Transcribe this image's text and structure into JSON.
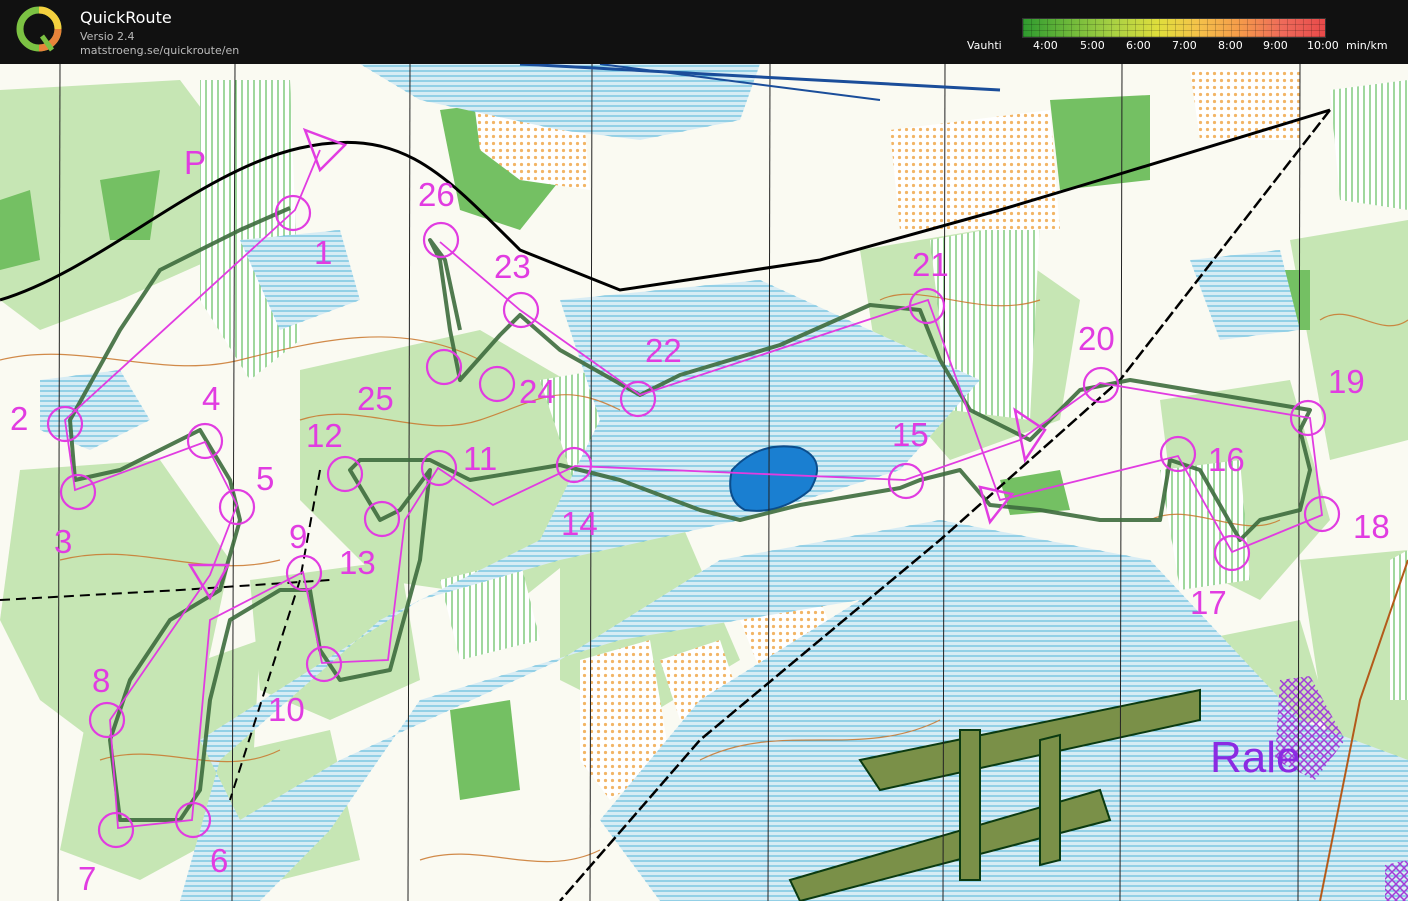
{
  "app": {
    "name": "QuickRoute",
    "version": "Versio 2.4",
    "url": "matstroeng.se/quickroute/en"
  },
  "legend": {
    "label": "Vauhti",
    "unit": "min/km",
    "ticks": [
      "4:00",
      "5:00",
      "6:00",
      "7:00",
      "8:00",
      "9:00",
      "10:00"
    ],
    "colors": {
      "slow": "#e84a4a",
      "medium": "#e0de3c",
      "fast": "#2f9a2f"
    }
  },
  "map": {
    "course_color": "#e13ce1",
    "route_color": "#3d6b3d",
    "parking_label": "P",
    "place_label": "Rale",
    "controls": [
      "1",
      "2",
      "3",
      "4",
      "5",
      "6",
      "7",
      "8",
      "9",
      "10",
      "11",
      "12",
      "13",
      "14",
      "15",
      "16",
      "17",
      "18",
      "19",
      "20",
      "21",
      "22",
      "23",
      "24",
      "25",
      "26"
    ]
  }
}
